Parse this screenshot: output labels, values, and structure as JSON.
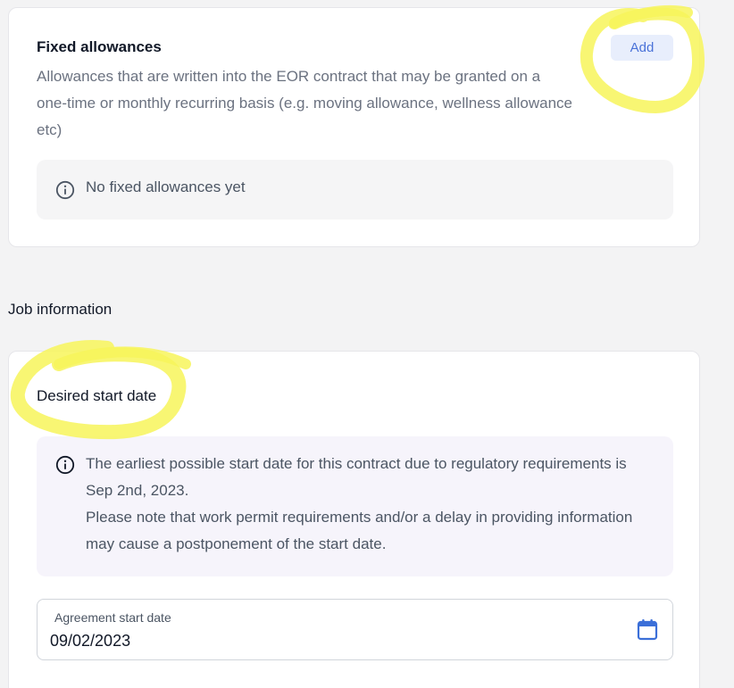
{
  "allowances": {
    "title": "Fixed allowances",
    "description": "Allowances that are written into the EOR contract that may be granted on a one-time or monthly recurring basis (e.g. moving allowance, wellness allowance etc)",
    "add_label": "Add",
    "empty_text": "No fixed allowances yet"
  },
  "job": {
    "heading": "Job information",
    "start_title": "Desired start date",
    "notice_line1": "The earliest possible start date for this contract due to regulatory requirements is Sep 2nd, 2023.",
    "notice_line2": "Please note that work permit requirements and/or a delay in providing information may cause a postponement of the start date.",
    "date_label": "Agreement start date",
    "date_value": "09/02/2023"
  },
  "icons": {
    "info": "info-icon",
    "calendar": "calendar-icon"
  },
  "colors": {
    "accent": "#4a72d8",
    "highlight": "#f7f55a",
    "calendar": "#3b6fd8"
  }
}
